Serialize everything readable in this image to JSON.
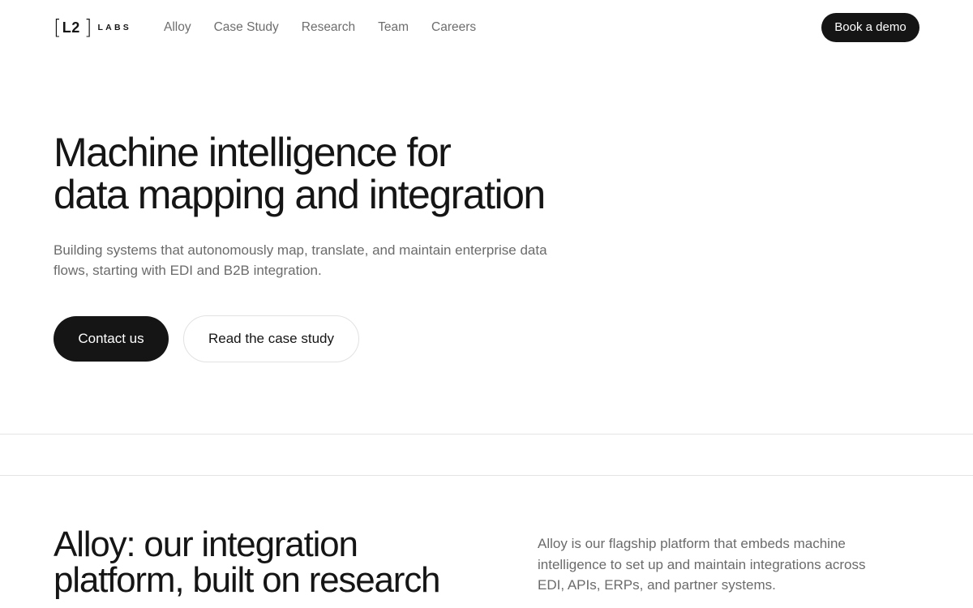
{
  "brand": {
    "logo_mark": "L2",
    "logo_text": "LABS"
  },
  "nav": {
    "items": [
      {
        "label": "Alloy"
      },
      {
        "label": "Case Study"
      },
      {
        "label": "Research"
      },
      {
        "label": "Team"
      },
      {
        "label": "Careers"
      }
    ],
    "cta_label": "Book a demo"
  },
  "hero": {
    "title_line1": "Machine intelligence for",
    "title_line2": "data mapping and integration",
    "subtitle": "Building systems that autonomously map, translate, and maintain enterprise data flows, starting with EDI and B2B integration.",
    "primary_button": "Contact us",
    "secondary_button": "Read the case study"
  },
  "alloy_section": {
    "title_line1": "Alloy: our integration",
    "title_line2": "platform, built on research",
    "description": "Alloy is our flagship platform that embeds machine intelligence to set up and maintain integrations across EDI, APIs, ERPs, and partner systems."
  },
  "colors": {
    "primary": "#151515",
    "muted_text": "#6b6b6b",
    "border": "#e4e4e4",
    "background": "#ffffff"
  }
}
